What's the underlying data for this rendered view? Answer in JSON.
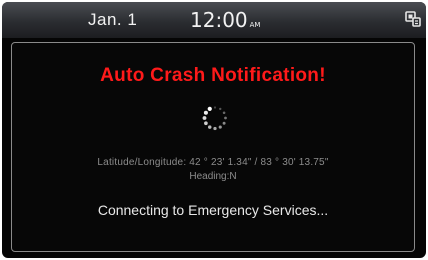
{
  "status_bar": {
    "date": "Jan. 1",
    "time": "12:00",
    "ampm": "AM",
    "phone_icon": "phone-connected-icon"
  },
  "dialog": {
    "title": "Auto Crash Notification!",
    "loading_icon": "loading-spinner-icon",
    "coordinates": "Latitude/Longitude: 42 ° 23' 1.34\" / 83 ° 30' 13.75\"",
    "heading": "Heading:N",
    "message": "Connecting to Emergency Services..."
  },
  "colors": {
    "title": "#ff1a1a",
    "status_bar": "#2b2d31",
    "background": "#050505",
    "secondary_text": "#8c8c8c"
  }
}
